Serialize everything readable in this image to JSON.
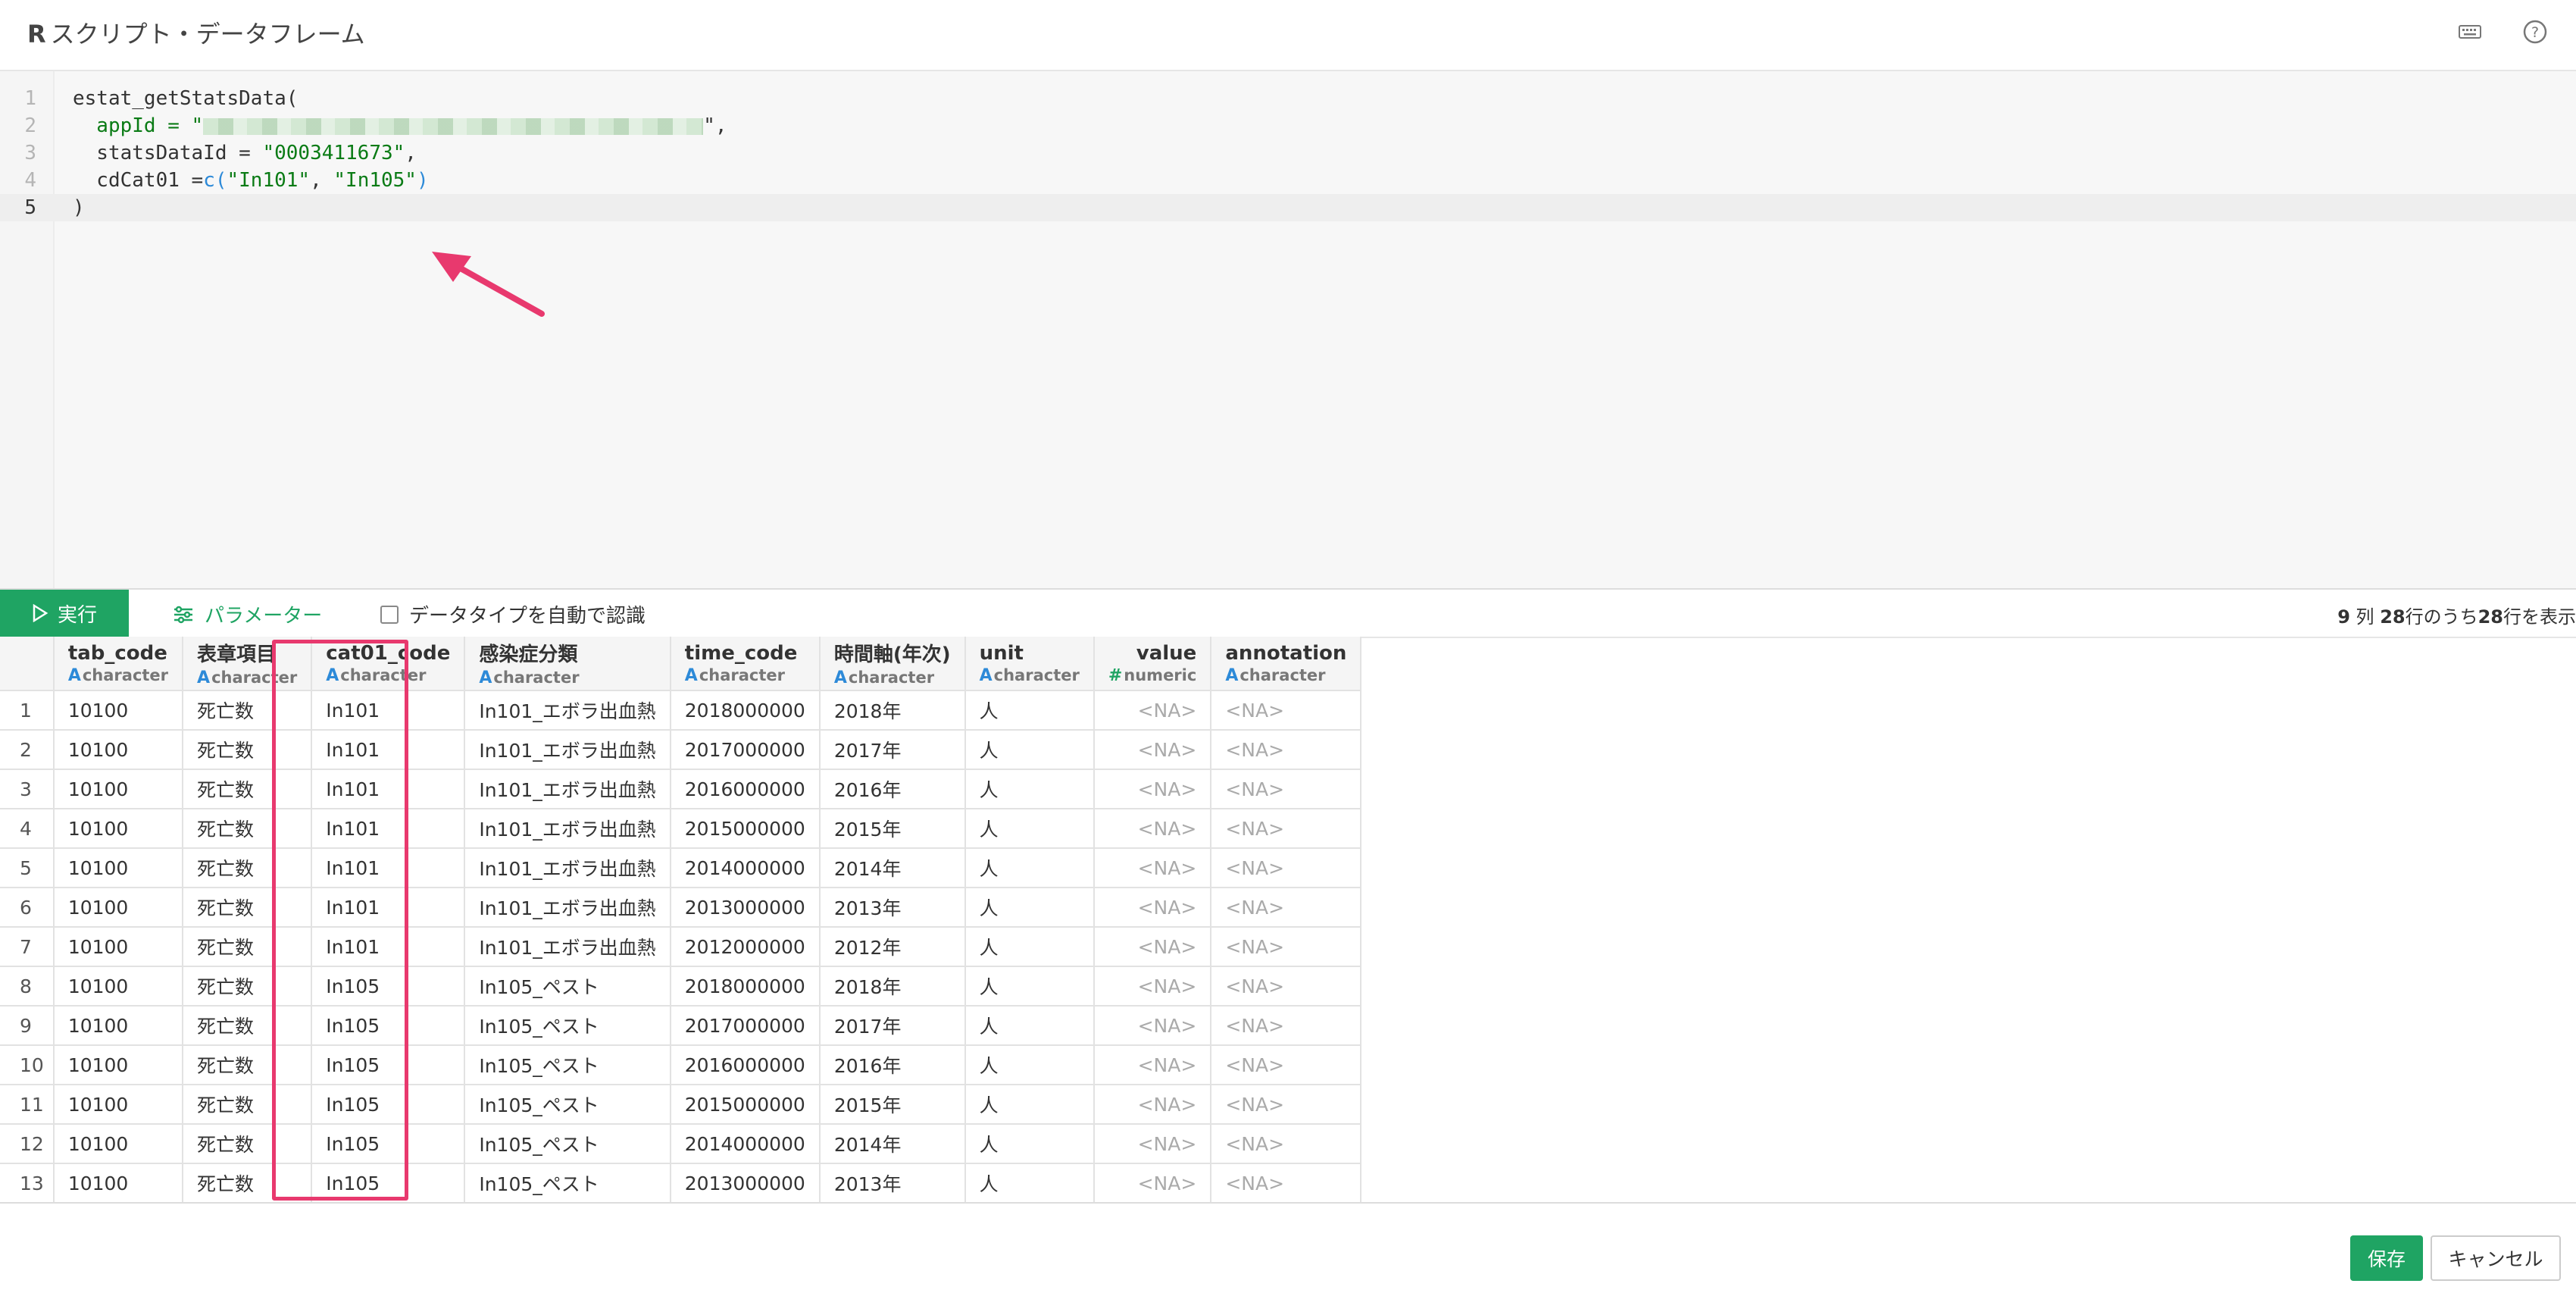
{
  "header": {
    "title_r": "R",
    "title": "スクリプト・データフレーム",
    "keyboard_icon": "keyboard-icon",
    "help_icon": "help-icon"
  },
  "editor": {
    "lines": [
      {
        "num": "1",
        "code": "estat_getStatsData("
      },
      {
        "num": "2",
        "code_prefix": "  appId = \"",
        "code_suffix": "\","
      },
      {
        "num": "3",
        "code_prefix": "  statsDataId = ",
        "code_str": "\"0003411673\"",
        "code_suffix": ","
      },
      {
        "num": "4",
        "code_prefix": "  cdCat01 =",
        "code_fn": "c",
        "code_paren": "(",
        "code_str1": "\"In101\"",
        "code_sep": ", ",
        "code_str2": "\"In105\"",
        "code_suffix": ")"
      },
      {
        "num": "5",
        "code": ")"
      }
    ]
  },
  "toolbar": {
    "run_label": "実行",
    "params_label": "パラメーター",
    "auto_type_label": "データタイプを自動で認識",
    "summary_cols": "9",
    "summary_cols_unit": " 列 ",
    "summary_total": "28",
    "summary_mid": "行のうち",
    "summary_shown": "28",
    "summary_end": "行を表示"
  },
  "table": {
    "columns": [
      {
        "name": "tab_code",
        "type": "character",
        "type_glyph": "A"
      },
      {
        "name": "表章項目",
        "type": "character",
        "type_glyph": "A"
      },
      {
        "name": "cat01_code",
        "type": "character",
        "type_glyph": "A"
      },
      {
        "name": "感染症分類",
        "type": "character",
        "type_glyph": "A"
      },
      {
        "name": "time_code",
        "type": "character",
        "type_glyph": "A"
      },
      {
        "name": "時間軸(年次)",
        "type": "character",
        "type_glyph": "A"
      },
      {
        "name": "unit",
        "type": "character",
        "type_glyph": "A"
      },
      {
        "name": "value",
        "type": "numeric",
        "type_glyph": "#"
      },
      {
        "name": "annotation",
        "type": "character",
        "type_glyph": "A"
      }
    ],
    "rows": [
      [
        "1",
        "10100",
        "死亡数",
        "In101",
        "In101_エボラ出血熱",
        "2018000000",
        "2018年",
        "人",
        "<NA>",
        "<NA>"
      ],
      [
        "2",
        "10100",
        "死亡数",
        "In101",
        "In101_エボラ出血熱",
        "2017000000",
        "2017年",
        "人",
        "<NA>",
        "<NA>"
      ],
      [
        "3",
        "10100",
        "死亡数",
        "In101",
        "In101_エボラ出血熱",
        "2016000000",
        "2016年",
        "人",
        "<NA>",
        "<NA>"
      ],
      [
        "4",
        "10100",
        "死亡数",
        "In101",
        "In101_エボラ出血熱",
        "2015000000",
        "2015年",
        "人",
        "<NA>",
        "<NA>"
      ],
      [
        "5",
        "10100",
        "死亡数",
        "In101",
        "In101_エボラ出血熱",
        "2014000000",
        "2014年",
        "人",
        "<NA>",
        "<NA>"
      ],
      [
        "6",
        "10100",
        "死亡数",
        "In101",
        "In101_エボラ出血熱",
        "2013000000",
        "2013年",
        "人",
        "<NA>",
        "<NA>"
      ],
      [
        "7",
        "10100",
        "死亡数",
        "In101",
        "In101_エボラ出血熱",
        "2012000000",
        "2012年",
        "人",
        "<NA>",
        "<NA>"
      ],
      [
        "8",
        "10100",
        "死亡数",
        "In105",
        "In105_ペスト",
        "2018000000",
        "2018年",
        "人",
        "<NA>",
        "<NA>"
      ],
      [
        "9",
        "10100",
        "死亡数",
        "In105",
        "In105_ペスト",
        "2017000000",
        "2017年",
        "人",
        "<NA>",
        "<NA>"
      ],
      [
        "10",
        "10100",
        "死亡数",
        "In105",
        "In105_ペスト",
        "2016000000",
        "2016年",
        "人",
        "<NA>",
        "<NA>"
      ],
      [
        "11",
        "10100",
        "死亡数",
        "In105",
        "In105_ペスト",
        "2015000000",
        "2015年",
        "人",
        "<NA>",
        "<NA>"
      ],
      [
        "12",
        "10100",
        "死亡数",
        "In105",
        "In105_ペスト",
        "2014000000",
        "2014年",
        "人",
        "<NA>",
        "<NA>"
      ],
      [
        "13",
        "10100",
        "死亡数",
        "In105",
        "In105_ペスト",
        "2013000000",
        "2013年",
        "人",
        "<NA>",
        "<NA>"
      ]
    ]
  },
  "footer": {
    "save_label": "保存",
    "cancel_label": "キャンセル"
  },
  "colors": {
    "accent_green": "#1fa463",
    "highlight_pink": "#e8396e",
    "string_green": "#0a7b15",
    "type_blue": "#2d8ad8"
  }
}
